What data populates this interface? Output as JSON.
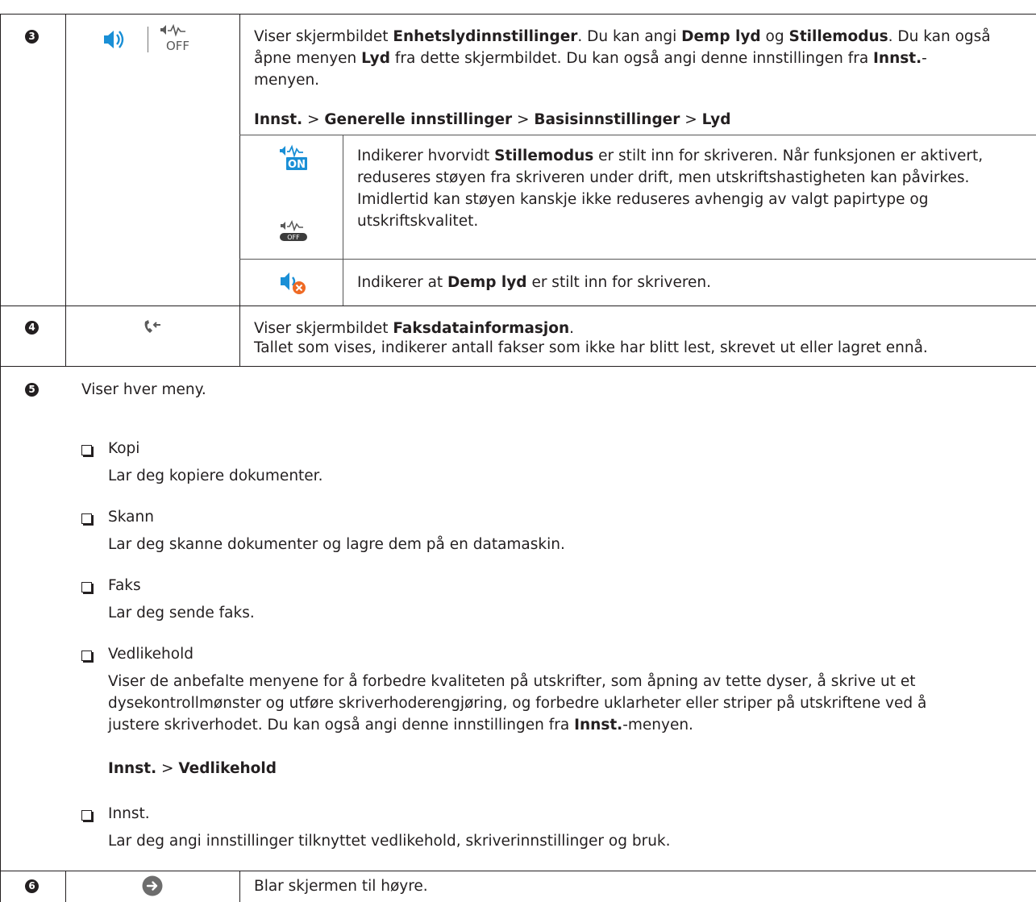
{
  "colors": {
    "icon_blue": "#1a8fd6",
    "icon_grey": "#5a5a5a",
    "cancel_orange": "#ef6a24",
    "text": "#231f20"
  },
  "rows": {
    "r3": {
      "number": "3",
      "icon_names": [
        "speaker-icon",
        "quiet-mode-off-icon"
      ],
      "desc": {
        "line1_a": "Viser skjermbildet ",
        "line1_b": "Enhetslydinnstillinger",
        "line1_c": ". Du kan angi ",
        "line1_d": "Demp lyd",
        "line1_e": " og ",
        "line1_f": "Stillemodus",
        "line1_g": ". Du kan også",
        "line2_a": "åpne menyen ",
        "line2_b": "Lyd",
        "line2_c": " fra dette skjermbildet. Du kan også angi denne innstillingen fra ",
        "line2_d": "Innst.",
        "line2_e": "-",
        "line3": "menyen."
      },
      "path": {
        "p1": "Innst.",
        "sep": " > ",
        "p2": "Generelle innstillinger",
        "p3": "Basisinnstillinger",
        "p4": "Lyd"
      },
      "sub": {
        "quiet": {
          "on_label": "ON",
          "off_label": "OFF",
          "a": "Indikerer hvorvidt ",
          "b": "Stillemodus",
          "c": " er stilt inn for skriveren. Når funksjonen er aktivert,",
          "l2": "reduseres støyen fra skriveren under drift, men utskriftshastigheten kan påvirkes.",
          "l3": "Imidlertid kan støyen kanskje ikke reduseres avhengig av valgt papirtype og",
          "l4": "utskriftskvalitet."
        },
        "mute": {
          "a": "Indikerer at ",
          "b": "Demp lyd",
          "c": " er stilt inn for skriveren."
        }
      }
    },
    "r4": {
      "number": "4",
      "icon_name": "fax-data-icon",
      "l1a": "Viser skjermbildet ",
      "l1b": "Faksdatainformasjon",
      "l1c": ".",
      "l2": "Tallet som vises, indikerer antall fakser som ikke har blitt lest, skrevet ut eller lagret ennå."
    },
    "r5": {
      "number": "5",
      "intro": "Viser hver meny.",
      "items": [
        {
          "label": "Kopi",
          "desc": "Lar deg kopiere dokumenter."
        },
        {
          "label": "Skann",
          "desc": "Lar deg skanne dokumenter og lagre dem på en datamaskin."
        },
        {
          "label": "Faks",
          "desc": "Lar deg sende faks."
        },
        {
          "label": "Vedlikehold",
          "desc_l1": "Viser de anbefalte menyene for å forbedre kvaliteten på utskrifter, som åpning av tette dyser, å skrive ut et",
          "desc_l2": "dysekontrollmønster og utføre skriverhoderengjøring, og forbedre uklarheter eller striper på utskriftene ved å",
          "desc_l3a": "justere skriverhodet. Du kan også angi denne innstillingen fra ",
          "desc_l3b": "Innst.",
          "desc_l3c": "-menyen.",
          "path_a": "Innst.",
          "path_sep": " > ",
          "path_b": "Vedlikehold"
        },
        {
          "label": "Innst.",
          "desc": "Lar deg angi innstillinger tilknyttet vedlikehold, skriverinnstillinger og bruk."
        }
      ]
    },
    "r6": {
      "number": "6",
      "icon_name": "scroll-right-icon",
      "desc": "Blar skjermen til høyre."
    }
  }
}
